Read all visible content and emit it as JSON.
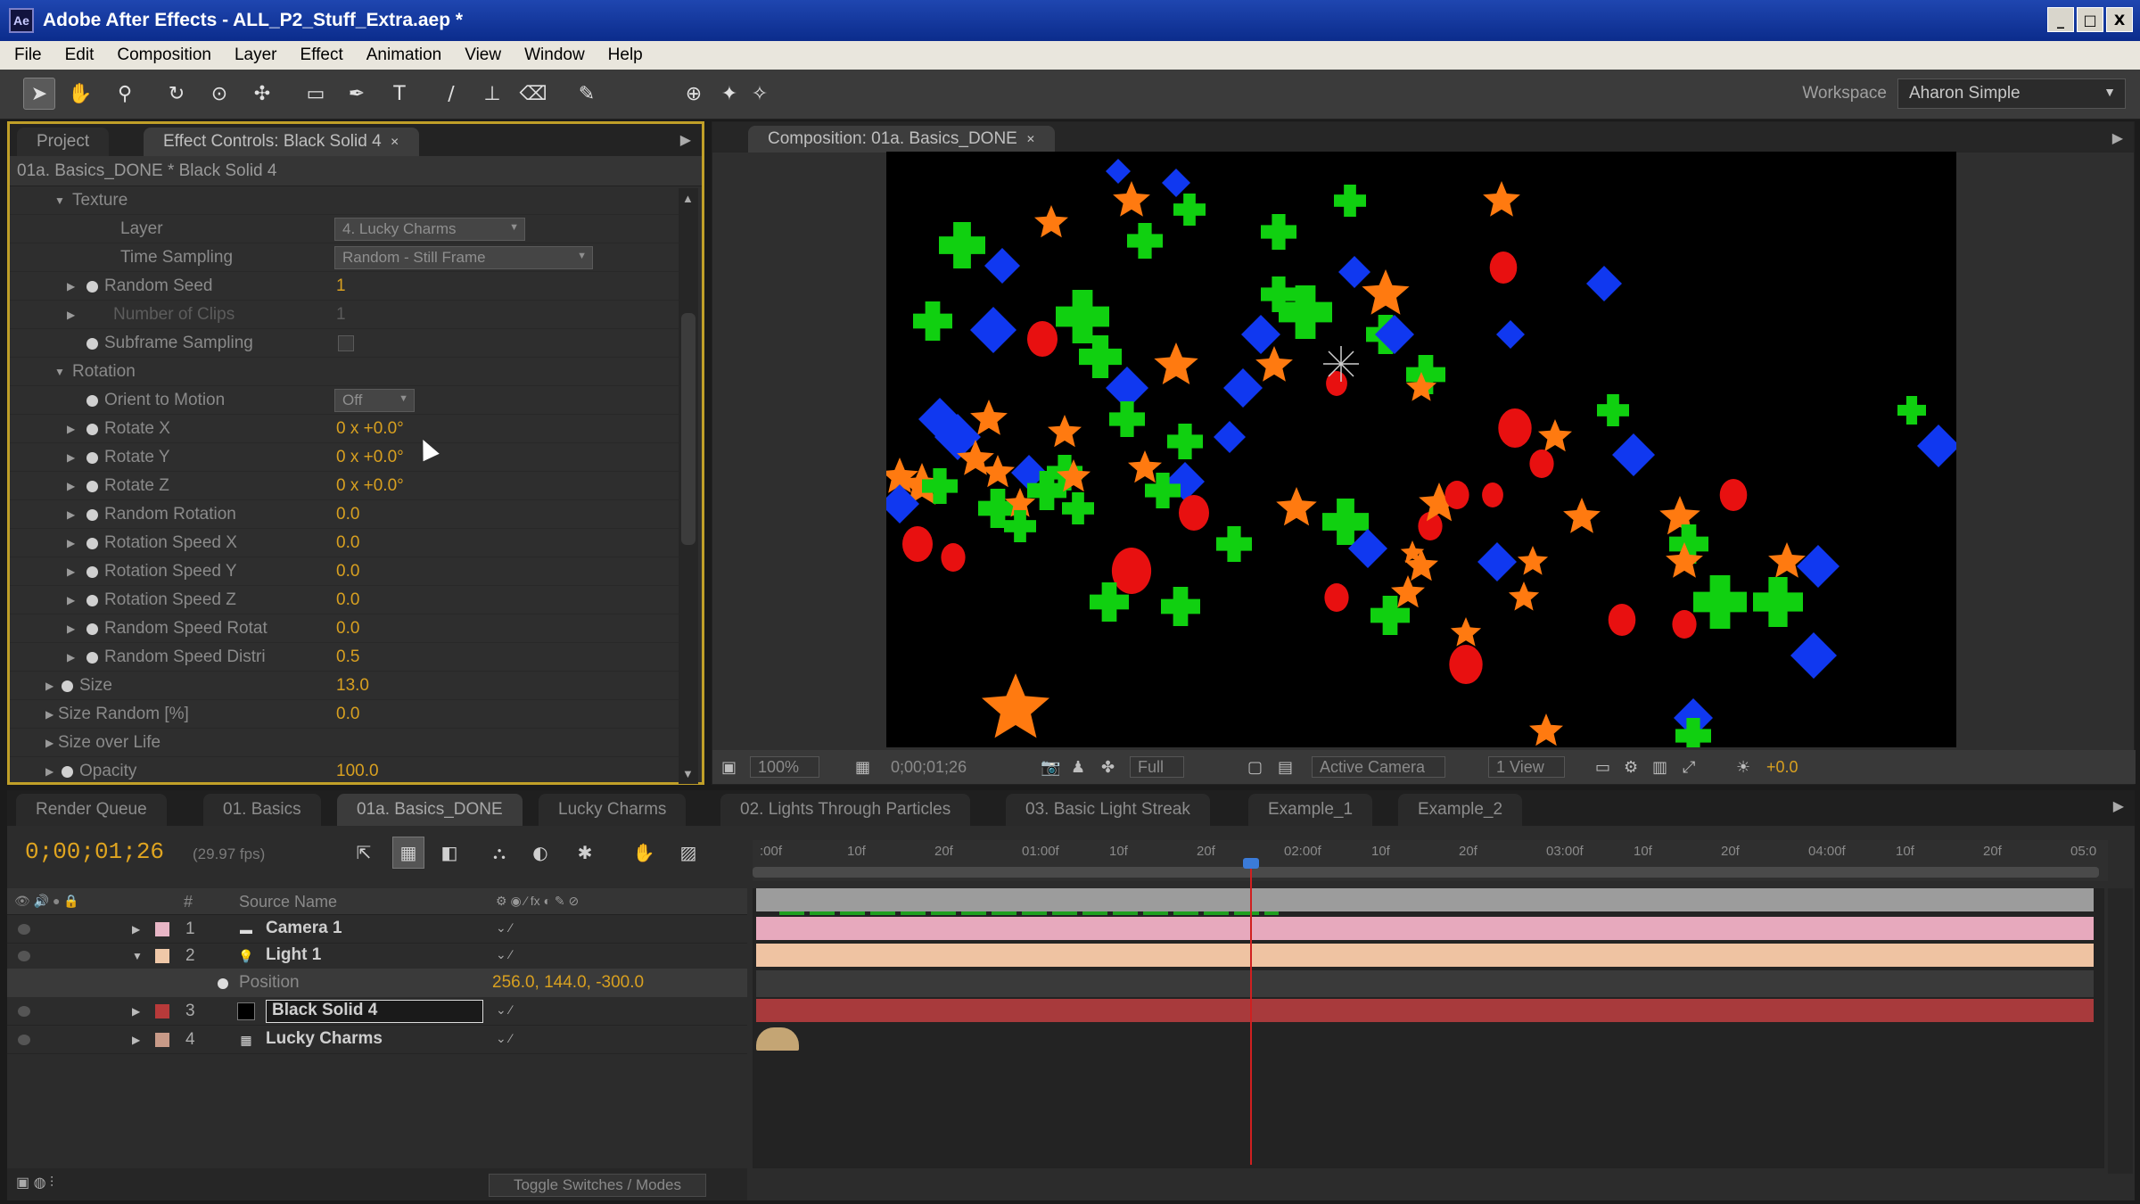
{
  "window": {
    "title": "Adobe After Effects - ALL_P2_Stuff_Extra.aep *",
    "logo": "Ae",
    "minimize": "_",
    "maximize": "□",
    "close": "X"
  },
  "menu": [
    "File",
    "Edit",
    "Composition",
    "Layer",
    "Effect",
    "Animation",
    "View",
    "Window",
    "Help"
  ],
  "workspace": {
    "label": "Workspace",
    "value": "Aharon Simple"
  },
  "effect_panel": {
    "tab_project": "Project",
    "tab_effect_controls": "Effect Controls: Black Solid 4",
    "header": "01a. Basics_DONE * Black Solid 4",
    "rows": [
      {
        "name": "Texture",
        "kind": "group",
        "indent": 1,
        "expanded": true
      },
      {
        "name": "Layer",
        "kind": "dropdown",
        "indent": 3,
        "value": "4. Lucky Charms"
      },
      {
        "name": "Time Sampling",
        "kind": "dropdown",
        "indent": 3,
        "value": "Random - Still Frame"
      },
      {
        "name": "Random Seed",
        "kind": "prop",
        "indent": 3,
        "value": "1",
        "twirl": true,
        "stopwatch": true
      },
      {
        "name": "Number of Clips",
        "kind": "prop",
        "indent": 3,
        "value": "1",
        "twirl": true,
        "dim": true
      },
      {
        "name": "Subframe Sampling",
        "kind": "check",
        "indent": 3,
        "stopwatch": true
      },
      {
        "name": "Rotation",
        "kind": "group",
        "indent": 1,
        "expanded": true
      },
      {
        "name": "Orient to Motion",
        "kind": "dropdown",
        "indent": 3,
        "value": "Off",
        "stopwatch": true
      },
      {
        "name": "Rotate X",
        "kind": "prop",
        "indent": 3,
        "value": "0 x +0.0°",
        "twirl": true,
        "stopwatch": true
      },
      {
        "name": "Rotate Y",
        "kind": "prop",
        "indent": 3,
        "value": "0 x +0.0°",
        "twirl": true,
        "stopwatch": true
      },
      {
        "name": "Rotate Z",
        "kind": "prop",
        "indent": 3,
        "value": "0 x +0.0°",
        "twirl": true,
        "stopwatch": true
      },
      {
        "name": "Random Rotation",
        "kind": "prop",
        "indent": 3,
        "value": "0.0",
        "twirl": true,
        "stopwatch": true
      },
      {
        "name": "Rotation Speed X",
        "kind": "prop",
        "indent": 3,
        "value": "0.0",
        "twirl": true,
        "stopwatch": true
      },
      {
        "name": "Rotation Speed Y",
        "kind": "prop",
        "indent": 3,
        "value": "0.0",
        "twirl": true,
        "stopwatch": true
      },
      {
        "name": "Rotation Speed Z",
        "kind": "prop",
        "indent": 3,
        "value": "0.0",
        "twirl": true,
        "stopwatch": true
      },
      {
        "name": "Random Speed Rotat",
        "kind": "prop",
        "indent": 3,
        "value": "0.0",
        "twirl": true,
        "stopwatch": true
      },
      {
        "name": "Random Speed Distri",
        "kind": "prop",
        "indent": 3,
        "value": "0.5",
        "twirl": true,
        "stopwatch": true
      },
      {
        "name": "Size",
        "kind": "prop",
        "indent": 1,
        "value": "13.0",
        "twirl": true,
        "stopwatch": true
      },
      {
        "name": "Size Random [%]",
        "kind": "prop",
        "indent": 1,
        "value": "0.0",
        "twirl": true
      },
      {
        "name": "Size over Life",
        "kind": "prop",
        "indent": 1,
        "value": "",
        "twirl": true
      },
      {
        "name": "Opacity",
        "kind": "prop",
        "indent": 1,
        "value": "100.0",
        "twirl": true,
        "stopwatch": true
      }
    ]
  },
  "comp_panel": {
    "tab": "Composition: 01a. Basics_DONE",
    "footer": {
      "zoom": "100%",
      "timecode": "0;00;01;26",
      "resolution": "Full",
      "camera": "Active Camera",
      "views": "1 View",
      "exposure": "+0.0"
    }
  },
  "timeline": {
    "tabs": [
      "Render Queue",
      "01. Basics",
      "01a. Basics_DONE",
      "Lucky Charms",
      "02. Lights Through Particles",
      "03. Basic Light Streak",
      "Example_1",
      "Example_2"
    ],
    "active_tab": "01a. Basics_DONE",
    "timecode": "0;00;01;26",
    "fps": "(29.97 fps)",
    "col_hash": "#",
    "col_source": "Source Name",
    "ruler": [
      ":00f",
      "10f",
      "20f",
      "01:00f",
      "10f",
      "20f",
      "02:00f",
      "10f",
      "20f",
      "03:00f",
      "10f",
      "20f",
      "04:00f",
      "10f",
      "20f",
      "05:0"
    ],
    "layers": [
      {
        "num": "1",
        "name": "Camera 1",
        "icon": "camera",
        "label": "#e8b6c6",
        "bar": "#e7a9bd",
        "expanded": false
      },
      {
        "num": "2",
        "name": "Light 1",
        "icon": "light",
        "label": "#efc8a8",
        "bar": "#efc3a2",
        "expanded": true
      },
      {
        "num": "3",
        "name": "Black Solid 4",
        "icon": "solid",
        "label": "#b83a3a",
        "bar": "#a83a3c",
        "expanded": false
      },
      {
        "num": "4",
        "name": "Lucky Charms",
        "icon": "comp",
        "label": "#c89a88",
        "bar": "#c4a574",
        "expanded": false
      }
    ],
    "position_prop": {
      "name": "Position",
      "value": "256.0, 144.0, -300.0"
    },
    "toggle_label": "Toggle Switches / Modes"
  }
}
